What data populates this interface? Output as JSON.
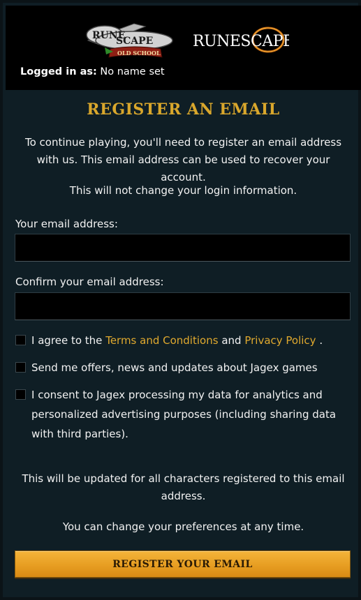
{
  "header": {
    "logged_in_label": "Logged in as:",
    "logged_in_value": "No name set",
    "osrs_logo_text": {
      "line1": "RUNE",
      "line2": "SCAPE",
      "banner": "OLD SCHOOL"
    },
    "rs_logo_text": "RUNESCAPE"
  },
  "form": {
    "title": "REGISTER AN EMAIL",
    "intro": "To continue playing, you'll need to register an email address with us. This email address can be used to recover your account.",
    "no_change": "This will not change your login information.",
    "email_label": "Your email address:",
    "email_value": "",
    "confirm_label": "Confirm your email address:",
    "confirm_value": ""
  },
  "consents": {
    "terms_prefix": "I agree to the",
    "terms_link": "Terms and Conditions",
    "terms_and": "and",
    "privacy_link": "Privacy Policy",
    "terms_suffix": ".",
    "offers": "Send me offers, news and updates about Jagex games",
    "analytics": "I consent to Jagex processing my data for analytics and personalized advertising purposes (including sharing data with third parties)."
  },
  "footer": {
    "updated_note": "This will be updated for all characters registered to this email address.",
    "prefs_note": "You can change your preferences at any time.",
    "register_button": "REGISTER YOUR EMAIL"
  },
  "colors": {
    "background": "#0f1e25",
    "header": "#000000",
    "accent_gold": "#d9a72c",
    "button": "#e79e22"
  }
}
